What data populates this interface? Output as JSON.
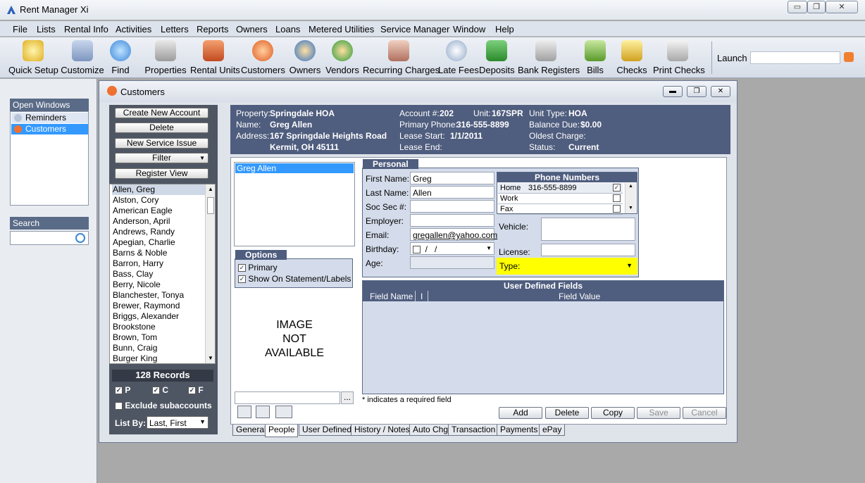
{
  "app": {
    "title": "Rent Manager Xi"
  },
  "menu": [
    "File",
    "Lists",
    "Rental Info",
    "Activities",
    "Letters",
    "Reports",
    "Owners",
    "Loans",
    "Metered Utilities",
    "Service Manager",
    "Window",
    "Help"
  ],
  "toolbar": {
    "buttons": [
      "Quick Setup",
      "Customize",
      "Find",
      "Properties",
      "Rental Units",
      "Customers",
      "Owners",
      "Vendors",
      "Recurring Charges",
      "Late Fees",
      "Deposits",
      "Bank Registers",
      "Bills",
      "Checks",
      "Print Checks"
    ],
    "launch_label": "Launch"
  },
  "left_pane": {
    "open_windows_title": "Open Windows",
    "open_windows": [
      "Reminders",
      "Customers"
    ],
    "search_title": "Search"
  },
  "customers": {
    "window_title": "Customers",
    "actions": [
      "Create New Account",
      "Delete",
      "New Service Issue",
      "Filter",
      "Register View"
    ],
    "list": [
      "Allen, Greg",
      "Alston, Cory",
      "American Eagle",
      "Anderson, April",
      "Andrews, Randy",
      "Apegian, Charlie",
      "Barns & Noble",
      "Barron, Harry",
      "Bass, Clay",
      "Berry, Nicole",
      "Blanchester, Tonya",
      "Brewer, Raymond",
      "Briggs, Alexander",
      "Brookstone",
      "Brown, Tom",
      "Bunn, Craig",
      "Burger King"
    ],
    "records": "128 Records",
    "filters": {
      "p": "P",
      "c": "C",
      "f": "F",
      "exclude": "Exclude subaccounts",
      "list_by_label": "List By:",
      "list_by_value": "Last, First"
    }
  },
  "info": {
    "property_label": "Property:",
    "property": "Springdale HOA",
    "name_label": "Name:",
    "name": "Greg Allen",
    "address_label": "Address:",
    "address1": "167 Springdale Heights Road",
    "address2": "Kermit, OH 45111",
    "account_label": "Account #:",
    "account": "202",
    "unit_label": "Unit:",
    "unit": "167SPR",
    "phone_label": "Primary Phone:",
    "phone": "316-555-8899",
    "lease_start_label": "Lease Start:",
    "lease_start": "1/1/2011",
    "lease_end_label": "Lease End:",
    "unit_type_label": "Unit Type:",
    "unit_type": "HOA",
    "balance_label": "Balance Due:",
    "balance": "$0.00",
    "oldest_label": "Oldest Charge:",
    "status_label": "Status:",
    "status": "Current"
  },
  "people": {
    "selected": "Greg Allen",
    "options_title": "Options",
    "primary": "Primary",
    "show_statement": "Show On Statement/Labels",
    "image_text1": "IMAGE",
    "image_text2": "NOT",
    "image_text3": "AVAILABLE",
    "personal_title": "Personal",
    "first_name_label": "First Name:",
    "first_name": "Greg",
    "last_name_label": "Last Name:",
    "last_name": "Allen",
    "ssn_label": "Soc Sec #:",
    "employer_label": "Employer:",
    "email_label": "Email:",
    "email": "gregallen@yahoo.com",
    "birthday_label": "Birthday:",
    "birthday": "  /   /",
    "age_label": "Age:",
    "phone_title": "Phone Numbers",
    "phones": [
      {
        "type": "Home",
        "number": "316-555-8899"
      },
      {
        "type": "Work",
        "number": ""
      },
      {
        "type": "Fax",
        "number": ""
      }
    ],
    "vehicle_label": "Vehicle:",
    "license_label": "License:",
    "type_label": "Type:",
    "udf_title": "User Defined Fields",
    "udf_col1": "Field Name",
    "udf_col2": "I",
    "udf_col3": "Field Value",
    "required_note": "* indicates a required field",
    "buttons": [
      "Add",
      "Delete",
      "Copy",
      "Save",
      "Cancel"
    ],
    "browse": "..."
  },
  "tabs": [
    "General",
    "People",
    "User Defined",
    "History / Notes",
    "Auto Chg",
    "Transaction",
    "Payments",
    "ePay"
  ],
  "colors": {
    "header_bg": "#4f5d7e",
    "highlight": "#ffff00",
    "selection": "#3399ff"
  }
}
